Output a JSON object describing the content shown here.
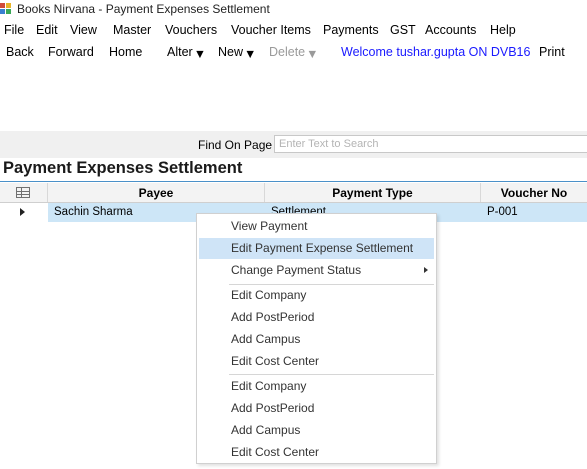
{
  "window": {
    "title": "Books Nirvana - Payment Expenses Settlement"
  },
  "menubar": [
    "File",
    "Edit",
    "View",
    "Master",
    "Vouchers",
    "Voucher Items",
    "Payments",
    "GST",
    "Accounts",
    "Help"
  ],
  "toolbar": {
    "back": "Back",
    "forward": "Forward",
    "home": "Home",
    "alter": "Alter",
    "new": "New",
    "delete": "Delete",
    "welcome": "Welcome tushar.gupta ON DVB16",
    "print": "Print"
  },
  "find": {
    "label": "Find On Page",
    "placeholder": "Enter Text to Search",
    "value": ""
  },
  "page_title": "Payment Expenses Settlement",
  "grid": {
    "columns": [
      "Payee",
      "Payment Type",
      "Voucher No"
    ],
    "rows": [
      {
        "payee": "Sachin  Sharma",
        "payment_type": "Settlement",
        "voucher_no": "P-001"
      }
    ]
  },
  "context_menu": {
    "group1": [
      "View Payment",
      "Edit Payment Expense Settlement",
      "Change Payment Status"
    ],
    "group2": [
      "Edit Company",
      "Add PostPeriod",
      "Add Campus",
      "Edit Cost Center"
    ],
    "group3": [
      "Edit Company",
      "Add PostPeriod",
      "Add Campus",
      "Edit Cost Center"
    ],
    "highlighted": "Edit Payment Expense Settlement"
  },
  "colors": {
    "accent": "#4a90c8",
    "selection": "#cde6f7",
    "menu_hover": "#cfe4f7",
    "welcome_text": "#1a1aff",
    "disabled_text": "#9a9a9a"
  }
}
